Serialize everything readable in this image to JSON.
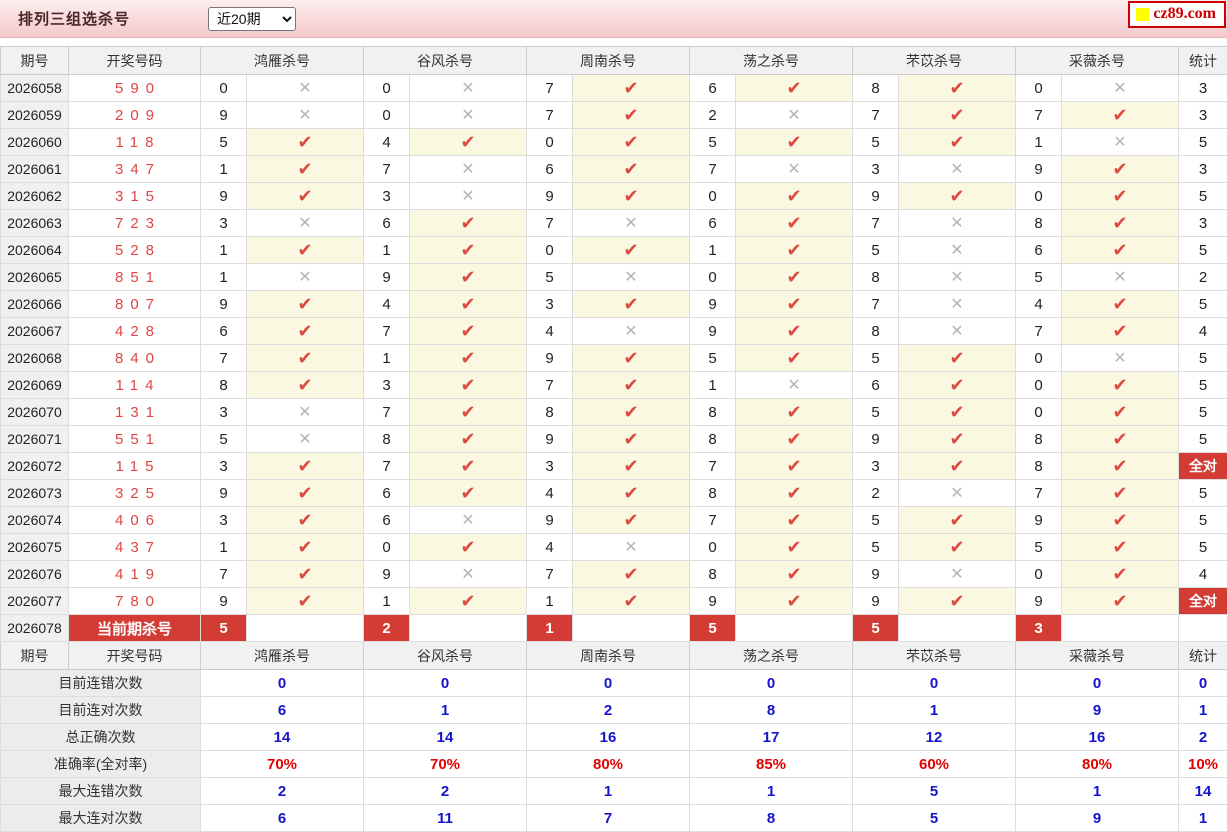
{
  "header": {
    "title": "排列三组选杀号",
    "range_value": "近20期",
    "logo_text": "cz89.com"
  },
  "icons": {
    "check": "✔",
    "cross": "✕"
  },
  "labels": {
    "full_hit": "全对"
  },
  "colors": {
    "accent_red": "#d23c34",
    "check_red": "#dc4a42",
    "cross_gray": "#b5b5b5",
    "draw_red": "#e04545",
    "stat_blue": "#1414cc",
    "pct_red": "#e60000",
    "hit_bg": "#fbf8e2",
    "topbar_pink": "#f5c9cd"
  },
  "table": {
    "columns": [
      "期号",
      "开奖号码",
      "鸿雁杀号",
      "谷风杀号",
      "周南杀号",
      "荡之杀号",
      "芣苡杀号",
      "采薇杀号",
      "统计"
    ],
    "rows": [
      {
        "period": "2026058",
        "draw": "590",
        "kills": [
          {
            "d": "0",
            "hit": false
          },
          {
            "d": "0",
            "hit": false
          },
          {
            "d": "7",
            "hit": true
          },
          {
            "d": "6",
            "hit": true
          },
          {
            "d": "8",
            "hit": true
          },
          {
            "d": "0",
            "hit": false
          }
        ],
        "stat": "3",
        "full": false
      },
      {
        "period": "2026059",
        "draw": "209",
        "kills": [
          {
            "d": "9",
            "hit": false
          },
          {
            "d": "0",
            "hit": false
          },
          {
            "d": "7",
            "hit": true
          },
          {
            "d": "2",
            "hit": false
          },
          {
            "d": "7",
            "hit": true
          },
          {
            "d": "7",
            "hit": true
          }
        ],
        "stat": "3",
        "full": false
      },
      {
        "period": "2026060",
        "draw": "118",
        "kills": [
          {
            "d": "5",
            "hit": true
          },
          {
            "d": "4",
            "hit": true
          },
          {
            "d": "0",
            "hit": true
          },
          {
            "d": "5",
            "hit": true
          },
          {
            "d": "5",
            "hit": true
          },
          {
            "d": "1",
            "hit": false
          }
        ],
        "stat": "5",
        "full": false
      },
      {
        "period": "2026061",
        "draw": "347",
        "kills": [
          {
            "d": "1",
            "hit": true
          },
          {
            "d": "7",
            "hit": false
          },
          {
            "d": "6",
            "hit": true
          },
          {
            "d": "7",
            "hit": false
          },
          {
            "d": "3",
            "hit": false
          },
          {
            "d": "9",
            "hit": true
          }
        ],
        "stat": "3",
        "full": false
      },
      {
        "period": "2026062",
        "draw": "315",
        "kills": [
          {
            "d": "9",
            "hit": true
          },
          {
            "d": "3",
            "hit": false
          },
          {
            "d": "9",
            "hit": true
          },
          {
            "d": "0",
            "hit": true
          },
          {
            "d": "9",
            "hit": true
          },
          {
            "d": "0",
            "hit": true
          }
        ],
        "stat": "5",
        "full": false
      },
      {
        "period": "2026063",
        "draw": "723",
        "kills": [
          {
            "d": "3",
            "hit": false
          },
          {
            "d": "6",
            "hit": true
          },
          {
            "d": "7",
            "hit": false
          },
          {
            "d": "6",
            "hit": true
          },
          {
            "d": "7",
            "hit": false
          },
          {
            "d": "8",
            "hit": true
          }
        ],
        "stat": "3",
        "full": false
      },
      {
        "period": "2026064",
        "draw": "528",
        "kills": [
          {
            "d": "1",
            "hit": true
          },
          {
            "d": "1",
            "hit": true
          },
          {
            "d": "0",
            "hit": true
          },
          {
            "d": "1",
            "hit": true
          },
          {
            "d": "5",
            "hit": false
          },
          {
            "d": "6",
            "hit": true
          }
        ],
        "stat": "5",
        "full": false
      },
      {
        "period": "2026065",
        "draw": "851",
        "kills": [
          {
            "d": "1",
            "hit": false
          },
          {
            "d": "9",
            "hit": true
          },
          {
            "d": "5",
            "hit": false
          },
          {
            "d": "0",
            "hit": true
          },
          {
            "d": "8",
            "hit": false
          },
          {
            "d": "5",
            "hit": false
          }
        ],
        "stat": "2",
        "full": false
      },
      {
        "period": "2026066",
        "draw": "807",
        "kills": [
          {
            "d": "9",
            "hit": true
          },
          {
            "d": "4",
            "hit": true
          },
          {
            "d": "3",
            "hit": true
          },
          {
            "d": "9",
            "hit": true
          },
          {
            "d": "7",
            "hit": false
          },
          {
            "d": "4",
            "hit": true
          }
        ],
        "stat": "5",
        "full": false
      },
      {
        "period": "2026067",
        "draw": "428",
        "kills": [
          {
            "d": "6",
            "hit": true
          },
          {
            "d": "7",
            "hit": true
          },
          {
            "d": "4",
            "hit": false
          },
          {
            "d": "9",
            "hit": true
          },
          {
            "d": "8",
            "hit": false
          },
          {
            "d": "7",
            "hit": true
          }
        ],
        "stat": "4",
        "full": false
      },
      {
        "period": "2026068",
        "draw": "840",
        "kills": [
          {
            "d": "7",
            "hit": true
          },
          {
            "d": "1",
            "hit": true
          },
          {
            "d": "9",
            "hit": true
          },
          {
            "d": "5",
            "hit": true
          },
          {
            "d": "5",
            "hit": true
          },
          {
            "d": "0",
            "hit": false
          }
        ],
        "stat": "5",
        "full": false
      },
      {
        "period": "2026069",
        "draw": "114",
        "kills": [
          {
            "d": "8",
            "hit": true
          },
          {
            "d": "3",
            "hit": true
          },
          {
            "d": "7",
            "hit": true
          },
          {
            "d": "1",
            "hit": false
          },
          {
            "d": "6",
            "hit": true
          },
          {
            "d": "0",
            "hit": true
          }
        ],
        "stat": "5",
        "full": false
      },
      {
        "period": "2026070",
        "draw": "131",
        "kills": [
          {
            "d": "3",
            "hit": false
          },
          {
            "d": "7",
            "hit": true
          },
          {
            "d": "8",
            "hit": true
          },
          {
            "d": "8",
            "hit": true
          },
          {
            "d": "5",
            "hit": true
          },
          {
            "d": "0",
            "hit": true
          }
        ],
        "stat": "5",
        "full": false
      },
      {
        "period": "2026071",
        "draw": "551",
        "kills": [
          {
            "d": "5",
            "hit": false
          },
          {
            "d": "8",
            "hit": true
          },
          {
            "d": "9",
            "hit": true
          },
          {
            "d": "8",
            "hit": true
          },
          {
            "d": "9",
            "hit": true
          },
          {
            "d": "8",
            "hit": true
          }
        ],
        "stat": "5",
        "full": false
      },
      {
        "period": "2026072",
        "draw": "115",
        "kills": [
          {
            "d": "3",
            "hit": true
          },
          {
            "d": "7",
            "hit": true
          },
          {
            "d": "3",
            "hit": true
          },
          {
            "d": "7",
            "hit": true
          },
          {
            "d": "3",
            "hit": true
          },
          {
            "d": "8",
            "hit": true
          }
        ],
        "stat": "全对",
        "full": true
      },
      {
        "period": "2026073",
        "draw": "325",
        "kills": [
          {
            "d": "9",
            "hit": true
          },
          {
            "d": "6",
            "hit": true
          },
          {
            "d": "4",
            "hit": true
          },
          {
            "d": "8",
            "hit": true
          },
          {
            "d": "2",
            "hit": false
          },
          {
            "d": "7",
            "hit": true
          }
        ],
        "stat": "5",
        "full": false
      },
      {
        "period": "2026074",
        "draw": "406",
        "kills": [
          {
            "d": "3",
            "hit": true
          },
          {
            "d": "6",
            "hit": false
          },
          {
            "d": "9",
            "hit": true
          },
          {
            "d": "7",
            "hit": true
          },
          {
            "d": "5",
            "hit": true
          },
          {
            "d": "9",
            "hit": true
          }
        ],
        "stat": "5",
        "full": false
      },
      {
        "period": "2026075",
        "draw": "437",
        "kills": [
          {
            "d": "1",
            "hit": true
          },
          {
            "d": "0",
            "hit": true
          },
          {
            "d": "4",
            "hit": false
          },
          {
            "d": "0",
            "hit": true
          },
          {
            "d": "5",
            "hit": true
          },
          {
            "d": "5",
            "hit": true
          }
        ],
        "stat": "5",
        "full": false
      },
      {
        "period": "2026076",
        "draw": "419",
        "kills": [
          {
            "d": "7",
            "hit": true
          },
          {
            "d": "9",
            "hit": false
          },
          {
            "d": "7",
            "hit": true
          },
          {
            "d": "8",
            "hit": true
          },
          {
            "d": "9",
            "hit": false
          },
          {
            "d": "0",
            "hit": true
          }
        ],
        "stat": "4",
        "full": false
      },
      {
        "period": "2026077",
        "draw": "780",
        "kills": [
          {
            "d": "9",
            "hit": true
          },
          {
            "d": "1",
            "hit": true
          },
          {
            "d": "1",
            "hit": true
          },
          {
            "d": "9",
            "hit": true
          },
          {
            "d": "9",
            "hit": true
          },
          {
            "d": "9",
            "hit": true
          }
        ],
        "stat": "全对",
        "full": true
      }
    ],
    "current_row": {
      "period": "2026078",
      "label": "当前期杀号",
      "kills": [
        "5",
        "2",
        "1",
        "5",
        "5",
        "3"
      ],
      "stat": ""
    }
  },
  "summary": {
    "rows": [
      {
        "label": "目前连错次数",
        "values": [
          "0",
          "0",
          "0",
          "0",
          "0",
          "0"
        ],
        "total": "0",
        "style": "blue"
      },
      {
        "label": "目前连对次数",
        "values": [
          "6",
          "1",
          "2",
          "8",
          "1",
          "9"
        ],
        "total": "1",
        "style": "blue"
      },
      {
        "label": "总正确次数",
        "values": [
          "14",
          "14",
          "16",
          "17",
          "12",
          "16"
        ],
        "total": "2",
        "style": "blue"
      },
      {
        "label": "准确率(全对率)",
        "values": [
          "70%",
          "70%",
          "80%",
          "85%",
          "60%",
          "80%"
        ],
        "total": "10%",
        "style": "red"
      },
      {
        "label": "最大连错次数",
        "values": [
          "2",
          "2",
          "1",
          "1",
          "5",
          "1"
        ],
        "total": "14",
        "style": "blue"
      },
      {
        "label": "最大连对次数",
        "values": [
          "6",
          "11",
          "7",
          "8",
          "5",
          "9"
        ],
        "total": "1",
        "style": "blue"
      }
    ]
  }
}
